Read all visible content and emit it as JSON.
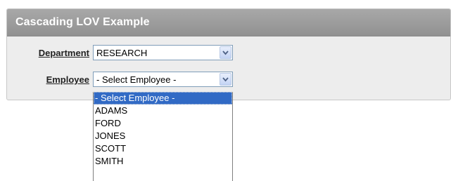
{
  "region": {
    "title": "Cascading LOV Example"
  },
  "department": {
    "label": "Department",
    "selected_value": "RESEARCH",
    "arrow_icon": "chevron-down-icon"
  },
  "employee": {
    "label": "Employee",
    "selected_value": "- Select Employee -",
    "arrow_icon": "chevron-down-icon",
    "options": [
      "- Select Employee -",
      "ADAMS",
      "FORD",
      "JONES",
      "SCOTT",
      "SMITH"
    ],
    "highlighted_option": "- Select Employee -"
  },
  "colors": {
    "header_gray": "#9b9b9b",
    "panel_bg": "#ededed",
    "selection_blue": "#316ac5",
    "select_border": "#7f9db9"
  }
}
